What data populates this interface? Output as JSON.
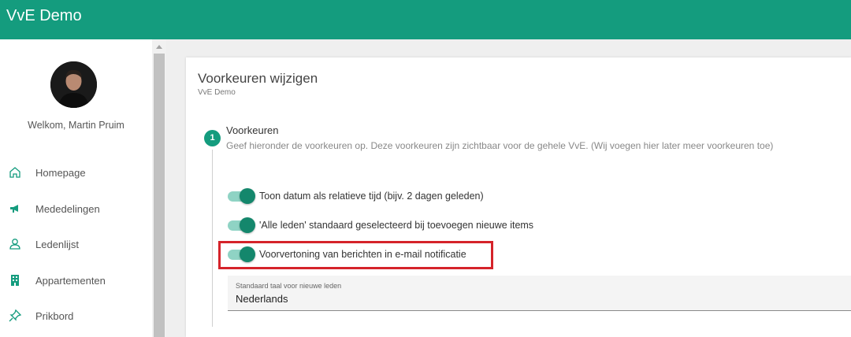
{
  "app": {
    "title": "VvE Demo"
  },
  "user": {
    "welcome": "Welkom, Martin Pruim"
  },
  "sidebar": {
    "items": [
      {
        "label": "Homepage",
        "icon": "home-icon"
      },
      {
        "label": "Mededelingen",
        "icon": "megaphone-icon"
      },
      {
        "label": "Ledenlijst",
        "icon": "user-icon"
      },
      {
        "label": "Appartementen",
        "icon": "building-icon"
      },
      {
        "label": "Prikbord",
        "icon": "pin-icon"
      }
    ]
  },
  "card": {
    "title": "Voorkeuren wijzigen",
    "subtitle": "VvE Demo"
  },
  "step": {
    "number": "1",
    "title": "Voorkeuren",
    "description": "Geef hieronder de voorkeuren op. Deze voorkeuren zijn zichtbaar voor de gehele VvE. (Wij voegen hier later meer voorkeuren toe)"
  },
  "toggles": [
    {
      "label": "Toon datum als relatieve tijd (bijv. 2 dagen geleden)",
      "on": true
    },
    {
      "label": "'Alle leden' standaard geselecteerd bij toevoegen nieuwe items",
      "on": true
    },
    {
      "label": "Voorvertoning van berichten in e-mail notificatie",
      "on": true
    }
  ],
  "language_select": {
    "label": "Standaard taal voor nieuwe leden",
    "value": "Nederlands"
  },
  "colors": {
    "brand": "#149c7e",
    "highlight": "#d5232a"
  }
}
